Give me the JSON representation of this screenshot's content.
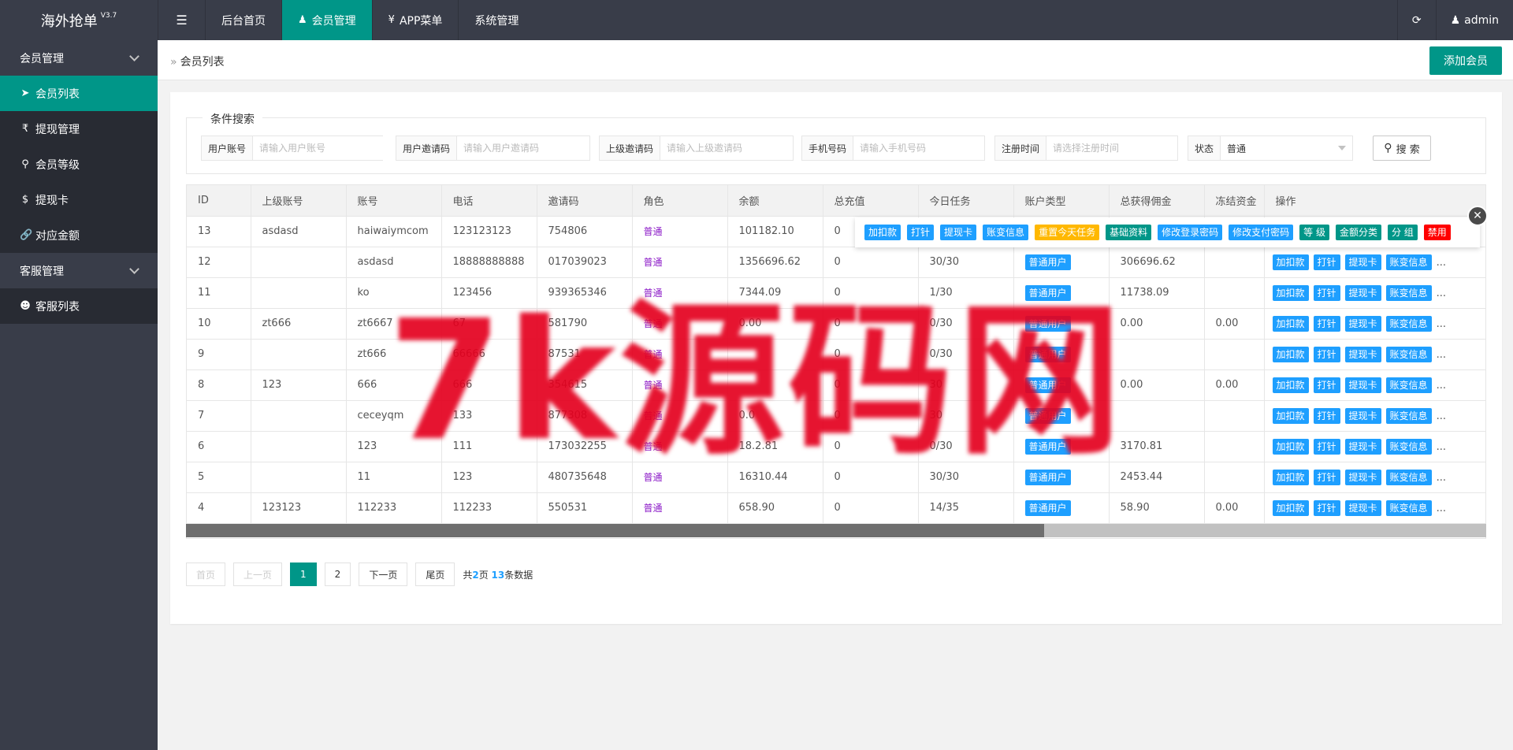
{
  "app": {
    "title": "海外抢单",
    "version": "V3.7"
  },
  "nav": {
    "items": [
      {
        "label": "后台首页",
        "icon": ""
      },
      {
        "label": "会员管理",
        "icon": "user-icon",
        "active": true
      },
      {
        "label": "APP菜单",
        "icon": "yen-icon"
      },
      {
        "label": "系统管理",
        "icon": ""
      }
    ],
    "user": "admin"
  },
  "sidebar": {
    "groups": [
      {
        "label": "会员管理",
        "items": [
          {
            "label": "会员列表",
            "icon": "rocket-icon",
            "active": true
          },
          {
            "label": "提现管理",
            "icon": "rupee-icon"
          },
          {
            "label": "会员等级",
            "icon": "search-icon"
          },
          {
            "label": "提现卡",
            "icon": "dollar-icon"
          },
          {
            "label": "对应金额",
            "icon": "link-icon"
          }
        ]
      },
      {
        "label": "客服管理",
        "items": [
          {
            "label": "客服列表",
            "icon": "users-icon"
          }
        ]
      }
    ]
  },
  "breadcrumb": {
    "sep": "»",
    "label": "会员列表"
  },
  "add_button": "添加会员",
  "search": {
    "legend": "条件搜索",
    "fields": [
      {
        "label": "用户账号",
        "placeholder": "请输入用户账号"
      },
      {
        "label": "用户邀请码",
        "placeholder": "请输入用户邀请码"
      },
      {
        "label": "上级邀请码",
        "placeholder": "请输入上级邀请码"
      },
      {
        "label": "手机号码",
        "placeholder": "请输入手机号码"
      },
      {
        "label": "注册时间",
        "placeholder": "请选择注册时间"
      }
    ],
    "status": {
      "label": "状态",
      "value": "普通"
    },
    "button": "搜 索"
  },
  "table": {
    "headers": [
      "ID",
      "上级账号",
      "账号",
      "电话",
      "邀请码",
      "角色",
      "余额",
      "总充值",
      "今日任务",
      "账户类型",
      "总获得佣金",
      "冻结资金",
      "操作"
    ],
    "op_labels": [
      "加扣款",
      "打针",
      "提现卡",
      "账变信息",
      "..."
    ],
    "rows": [
      [
        "13",
        "asdasd",
        "haiwaiymcom",
        "123123123",
        "754806",
        "普通",
        "101182.10",
        "0",
        "",
        "",
        "",
        "",
        ""
      ],
      [
        "12",
        "",
        "asdasd",
        "18888888888",
        "017039023",
        "普通",
        "1356696.62",
        "0",
        "30/30",
        "普通用户",
        "306696.62",
        "",
        ""
      ],
      [
        "11",
        "",
        "ko",
        "123456",
        "939365346",
        "普通",
        "7344.09",
        "0",
        "1/30",
        "普通用户",
        "11738.09",
        "",
        ""
      ],
      [
        "10",
        "zt666",
        "zt6667",
        "67",
        "581790",
        "普通",
        "0.00",
        "0",
        "0/30",
        "普通用户",
        "0.00",
        "0.00",
        ""
      ],
      [
        "9",
        "",
        "zt666",
        "66666",
        "87531",
        "普通",
        "",
        "0",
        "0/30",
        "普通用户",
        "",
        "",
        ""
      ],
      [
        "8",
        "123",
        "666",
        "666",
        "354615",
        "普通",
        "",
        "0",
        "30",
        "普通用户",
        "0.00",
        "0.00",
        ""
      ],
      [
        "7",
        "",
        "ceceyqm",
        "133",
        "877308",
        "普通",
        "0.0",
        "0",
        "30",
        "普通用户",
        "",
        "",
        ""
      ],
      [
        "6",
        "",
        "123",
        "111",
        "173032255",
        "普通",
        "18.2.81",
        "0",
        "0/30",
        "普通用户",
        "3170.81",
        "",
        ""
      ],
      [
        "5",
        "",
        "11",
        "123",
        "480735648",
        "普通",
        "16310.44",
        "0",
        "30/30",
        "普通用户",
        "2453.44",
        "",
        ""
      ],
      [
        "4",
        "123123",
        "112233",
        "112233",
        "550531",
        "普通",
        "658.90",
        "0",
        "14/35",
        "普通用户",
        "58.90",
        "0.00",
        ""
      ]
    ]
  },
  "popup": {
    "buttons": [
      {
        "label": "加扣款",
        "color": "#1e9fff"
      },
      {
        "label": "打针",
        "color": "#1e9fff"
      },
      {
        "label": "提现卡",
        "color": "#1e9fff"
      },
      {
        "label": "账变信息",
        "color": "#1e9fff"
      },
      {
        "label": "重置今天任务",
        "color": "#ffb800"
      },
      {
        "label": "基础资料",
        "color": "#009688"
      },
      {
        "label": "修改登录密码",
        "color": "#1e9fff"
      },
      {
        "label": "修改支付密码",
        "color": "#1e9fff"
      },
      {
        "label": "等 级",
        "color": "#009688"
      },
      {
        "label": "金额分类",
        "color": "#009688"
      },
      {
        "label": "分 组",
        "color": "#009688"
      },
      {
        "label": "禁用",
        "color": "#ff0000"
      }
    ]
  },
  "pager": {
    "first": "首页",
    "prev": "上一页",
    "pages": [
      "1",
      "2"
    ],
    "current": "1",
    "next": "下一页",
    "last": "尾页",
    "info_prefix": "共",
    "total_pages": "2",
    "info_mid": "页 ",
    "total_records": "13",
    "info_suffix": "条数据"
  },
  "watermark": "7k源码网",
  "colors": {
    "accent": "#009688",
    "header": "#393d49",
    "blue": "#1e9fff",
    "warn": "#ffb800",
    "danger": "#ff0000"
  }
}
